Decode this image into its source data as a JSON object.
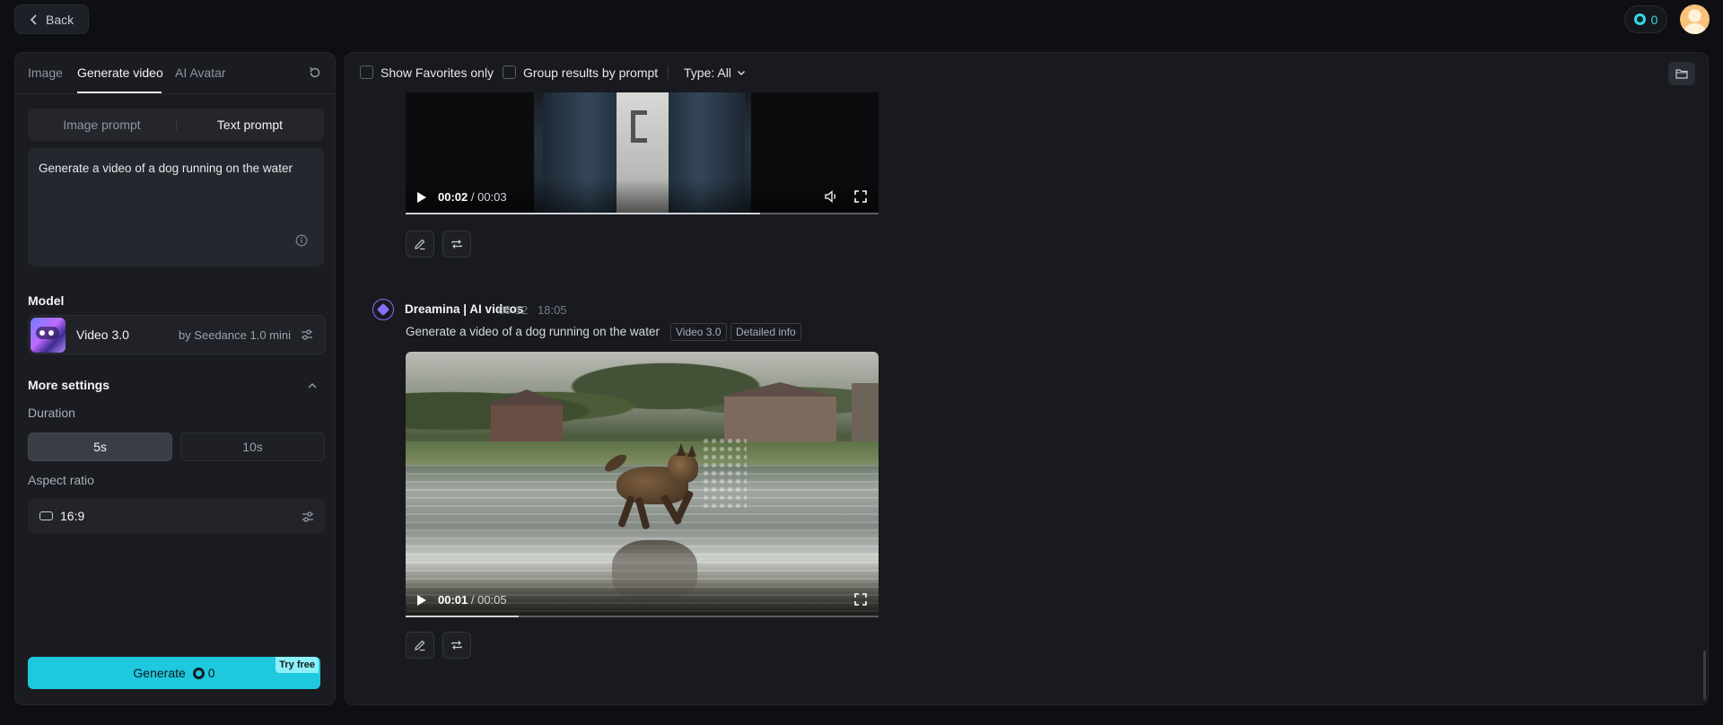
{
  "topbar": {
    "back_label": "Back",
    "credits": "0"
  },
  "left": {
    "tabs": [
      "Image",
      "Generate video",
      "AI Avatar"
    ],
    "prompt_modes": [
      "Image prompt",
      "Text prompt"
    ],
    "prompt_text": "Generate a video of a dog running on the water",
    "model_section": "Model",
    "model": {
      "name": "Video 3.0",
      "by": "by Seedance 1.0 mini"
    },
    "more_settings": "More settings",
    "duration_label": "Duration",
    "durations": [
      "5s",
      "10s"
    ],
    "aspect_label": "Aspect ratio",
    "aspect_value": "16:9",
    "generate": {
      "label": "Generate",
      "cost": "0",
      "badge": "Try free"
    },
    "colors": {
      "accent": "#1ec8de"
    }
  },
  "main": {
    "toolbar": {
      "favorites_label": "Show Favorites only",
      "group_label": "Group results by prompt",
      "type_label": "Type: All"
    },
    "video1": {
      "current": "00:02",
      "duration": "/ 00:03",
      "progress": 0.75
    },
    "generation": {
      "author": "Dreamina | AI videos",
      "date": "06-12",
      "time": "18:05",
      "prompt": "Generate a video of a dog running on the water",
      "tags": [
        "Video 3.0",
        "Detailed info"
      ]
    },
    "video2": {
      "current": "00:01",
      "duration": "/ 00:05",
      "progress": 0.24
    }
  }
}
